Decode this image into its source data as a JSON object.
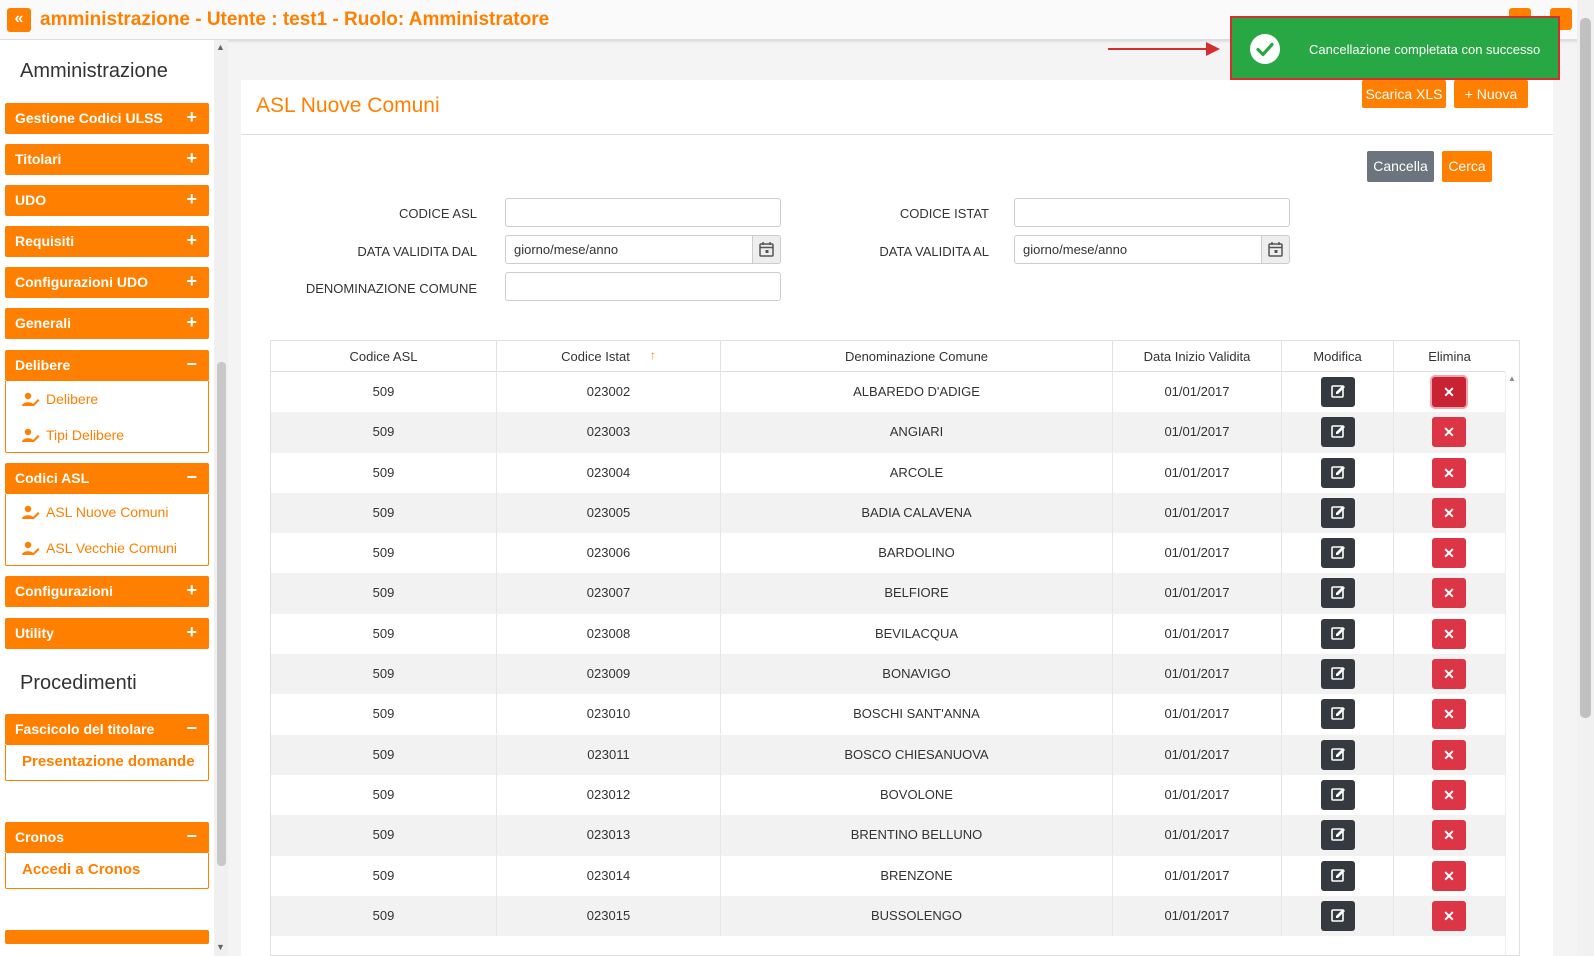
{
  "header": {
    "title": "amministrazione - Utente : test1 - Ruolo: Amministratore",
    "collapse_label": "«"
  },
  "sidebar": {
    "section_admin": "Amministrazione",
    "section_proc": "Procedimenti",
    "menu": {
      "gestione": "Gestione Codici ULSS",
      "titolari": "Titolari",
      "udo": "UDO",
      "requisiti": "Requisiti",
      "config_udo": "Configurazioni UDO",
      "generali": "Generali",
      "delibere": "Delibere",
      "codici_asl": "Codici ASL",
      "configurazioni": "Configurazioni",
      "utility": "Utility",
      "fascicolo": "Fascicolo del titolare",
      "cronos": "Cronos"
    },
    "delibere_items": [
      "Delibere",
      "Tipi Delibere"
    ],
    "codici_asl_items": [
      "ASL Nuove Comuni",
      "ASL Vecchie Comuni"
    ],
    "fascicolo_item": "Presentazione domande",
    "cronos_item": "Accedi a Cronos",
    "plus": "+",
    "minus": "−"
  },
  "page": {
    "title": "ASL Nuove Comuni",
    "btn_xls": "Scarica XLS",
    "btn_new": "+ Nuova",
    "btn_cancel": "Cancella",
    "btn_search": "Cerca"
  },
  "form": {
    "codice_asl_label": "CODICE ASL",
    "codice_istat_label": "CODICE ISTAT",
    "data_dal_label": "DATA VALIDITA DAL",
    "data_al_label": "DATA VALIDITA AL",
    "denominazione_label": "DENOMINAZIONE COMUNE",
    "date_placeholder": "giorno/mese/anno"
  },
  "table": {
    "headers": [
      "Codice ASL",
      "Codice Istat",
      "Denominazione Comune",
      "Data Inizio Validita",
      "Modifica",
      "Elimina"
    ],
    "sort_arrow": "↑",
    "delete_glyph": "✕",
    "rows": [
      {
        "asl": "509",
        "istat": "023002",
        "comune": "ALBAREDO D'ADIGE",
        "data": "01/01/2017"
      },
      {
        "asl": "509",
        "istat": "023003",
        "comune": "ANGIARI",
        "data": "01/01/2017"
      },
      {
        "asl": "509",
        "istat": "023004",
        "comune": "ARCOLE",
        "data": "01/01/2017"
      },
      {
        "asl": "509",
        "istat": "023005",
        "comune": "BADIA CALAVENA",
        "data": "01/01/2017"
      },
      {
        "asl": "509",
        "istat": "023006",
        "comune": "BARDOLINO",
        "data": "01/01/2017"
      },
      {
        "asl": "509",
        "istat": "023007",
        "comune": "BELFIORE",
        "data": "01/01/2017"
      },
      {
        "asl": "509",
        "istat": "023008",
        "comune": "BEVILACQUA",
        "data": "01/01/2017"
      },
      {
        "asl": "509",
        "istat": "023009",
        "comune": "BONAVIGO",
        "data": "01/01/2017"
      },
      {
        "asl": "509",
        "istat": "023010",
        "comune": "BOSCHI SANT'ANNA",
        "data": "01/01/2017"
      },
      {
        "asl": "509",
        "istat": "023011",
        "comune": "BOSCO CHIESANUOVA",
        "data": "01/01/2017"
      },
      {
        "asl": "509",
        "istat": "023012",
        "comune": "BOVOLONE",
        "data": "01/01/2017"
      },
      {
        "asl": "509",
        "istat": "023013",
        "comune": "BRENTINO BELLUNO",
        "data": "01/01/2017"
      },
      {
        "asl": "509",
        "istat": "023014",
        "comune": "BRENZONE",
        "data": "01/01/2017"
      },
      {
        "asl": "509",
        "istat": "023015",
        "comune": "BUSSOLENGO",
        "data": "01/01/2017"
      }
    ]
  },
  "toast": {
    "message": "Cancellazione completata con successo"
  },
  "colors": {
    "accent": "#ff8000",
    "success": "#28a745",
    "danger": "#dc3545",
    "dark": "#343a40"
  }
}
